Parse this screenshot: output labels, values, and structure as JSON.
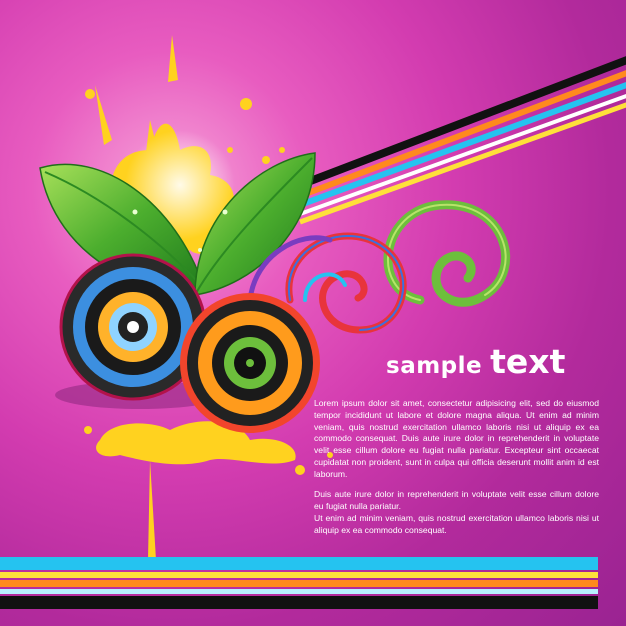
{
  "heading": {
    "word1": "sample",
    "word2": "text"
  },
  "paragraphs": [
    "Lorem ipsum dolor sit amet, consectetur adipisicing elit, sed do eiusmod tempor incididunt ut labore et dolore magna aliqua. Ut enim ad minim veniam, quis nostrud exercitation ullamco laboris nisi ut aliquip ex ea commodo consequat. Duis aute irure dolor in reprehenderit in voluptate velit esse cillum dolore eu fugiat nulla pariatur. Excepteur sint occaecat cupidatat non proident, sunt in culpa qui officia deserunt mollit anim id est laborum.",
    "Duis aute irure dolor in reprehenderit in voluptate velit esse cillum dolore eu fugiat nulla pariatur.",
    "Ut enim ad minim veniam, quis nostrud exercitation ullamco laboris nisi ut aliquip ex ea commodo consequat."
  ],
  "colors": {
    "background": "#d33cb0",
    "splash": "#ffd21f",
    "leaf": "#4cae2e",
    "ring_blue": "#3c8fe0",
    "ring_orange": "#ff9b1c",
    "ring_red": "#f2452c",
    "stripe_cyan": "#25c3f0",
    "stripe_yellow": "#ffe03a",
    "stripe_orange": "#ff8a1d",
    "stripe_black": "#111111",
    "swirl_green": "#6dbf3c",
    "swirl_red": "#e8343c"
  }
}
